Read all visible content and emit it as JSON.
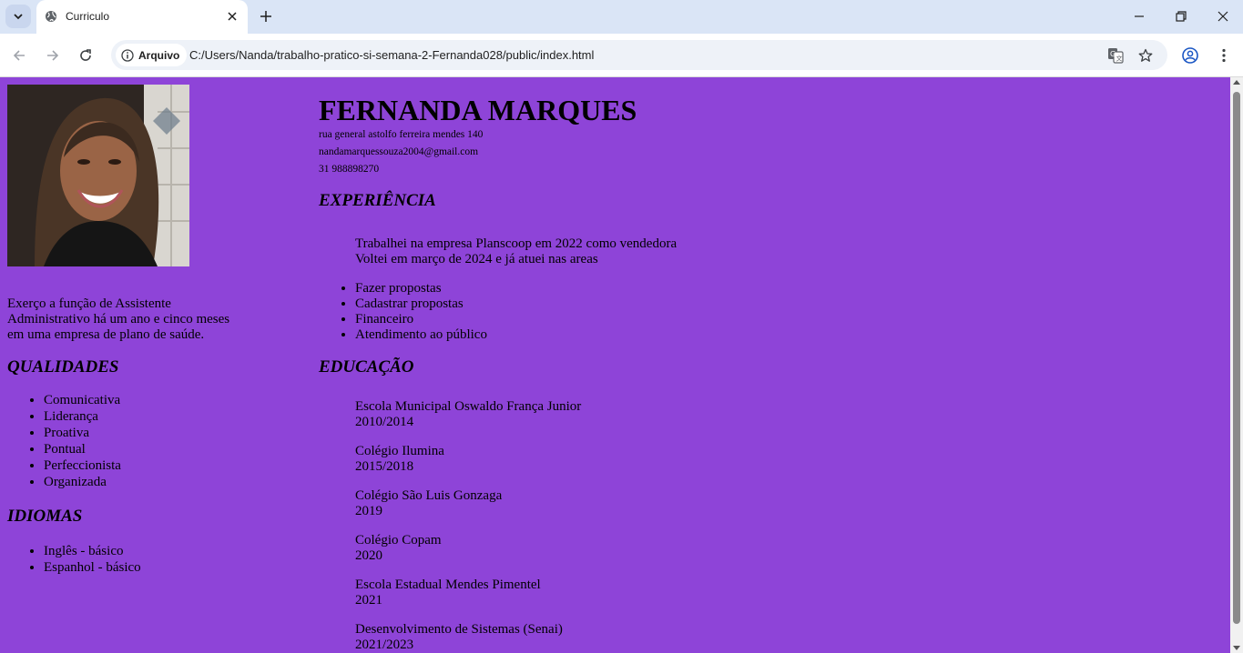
{
  "browser": {
    "tab_title": "Curriculo",
    "security_chip": "Arquivo",
    "url": "C:/Users/Nanda/trabalho-pratico-si-semana-2-Fernanda028/public/index.html"
  },
  "resume": {
    "name": "FERNANDA MARQUES",
    "address": "rua general astolfo ferreira mendes 140",
    "email": "nandamarquessouza2004@gmail.com",
    "phone": "31 988898270",
    "summary": "Exerço a função de Assistente Administrativo há um ano e cinco meses em uma empresa de plano de saúde.",
    "qualities_title": "QUALIDADES",
    "qualities": [
      "Comunicativa",
      "Liderança",
      "Proativa",
      "Pontual",
      "Perfeccionista",
      "Organizada"
    ],
    "languages_title": "IDIOMAS",
    "languages": [
      "Inglês - básico",
      "Espanhol - básico"
    ],
    "experience_title": "EXPERIÊNCIA",
    "experience_line1": "Trabalhei na empresa Planscoop em 2022 como vendedora",
    "experience_line2": "Voltei em março de 2024 e já atuei nas areas",
    "experience_areas": [
      "Fazer propostas",
      "Cadastrar propostas",
      "Financeiro",
      "Atendimento ao público"
    ],
    "education_title": "EDUCAÇÃO",
    "education": [
      {
        "school": "Escola Municipal Oswaldo França Junior",
        "years": "2010/2014"
      },
      {
        "school": "Colégio Ilumina",
        "years": "2015/2018"
      },
      {
        "school": "Colégio São Luis Gonzaga",
        "years": "2019"
      },
      {
        "school": "Colégio Copam",
        "years": "2020"
      },
      {
        "school": "Escola Estadual Mendes Pimentel",
        "years": "2021"
      },
      {
        "school": "Desenvolvimento de Sistemas (Senai)",
        "years": "2021/2023"
      }
    ]
  },
  "colors": {
    "page_background": "#8e44d8",
    "tabstrip": "#dae5f6"
  }
}
